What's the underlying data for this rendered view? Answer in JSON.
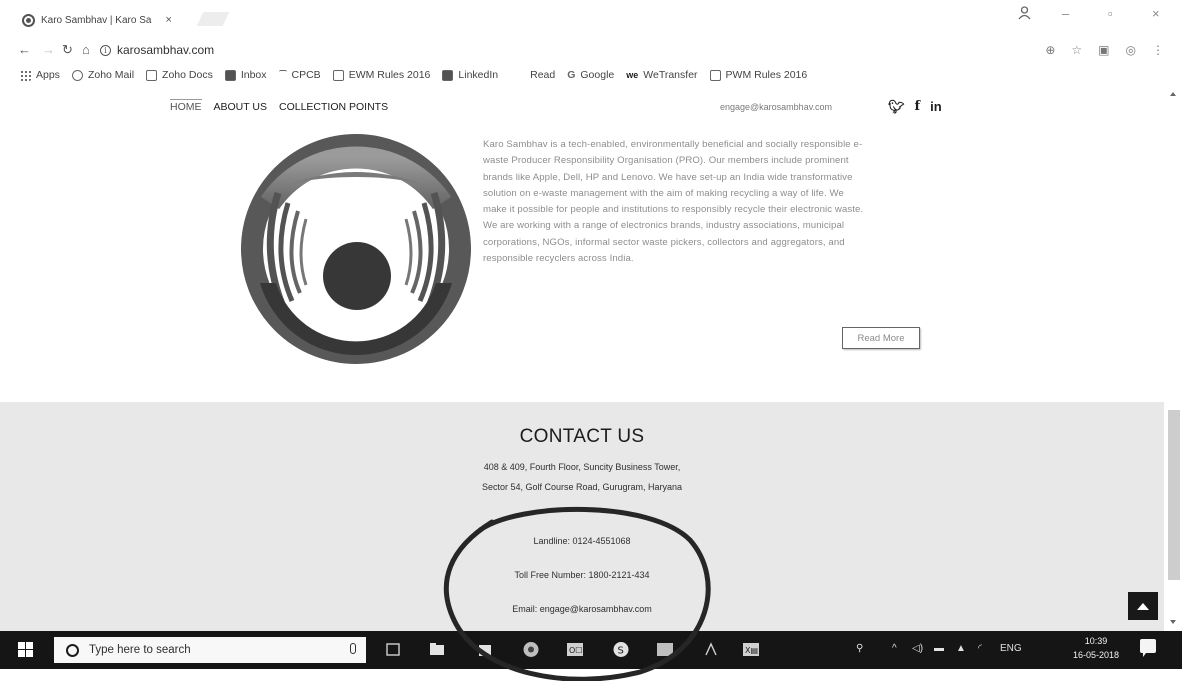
{
  "browser": {
    "tab_title": "Karo Sambhav | Karo Sa",
    "tab_close": "×",
    "url": "karosambhav.com",
    "bookmarks": [
      {
        "label": "Apps",
        "icon": "apps-grid-icon"
      },
      {
        "label": "Zoho Mail",
        "icon": "zoho-mail-icon"
      },
      {
        "label": "Zoho Docs",
        "icon": "zoho-docs-icon"
      },
      {
        "label": "Inbox",
        "icon": "inbox-icon"
      },
      {
        "label": "CPCB",
        "icon": "page-icon"
      },
      {
        "label": "EWM Rules 2016",
        "icon": "page-icon"
      },
      {
        "label": "LinkedIn",
        "icon": "linkedin-icon"
      },
      {
        "label": "Read",
        "icon": "read-icon"
      },
      {
        "label": "Google",
        "icon": "google-icon"
      },
      {
        "label": "WeTransfer",
        "icon": "wetransfer-icon"
      },
      {
        "label": "PWM Rules 2016",
        "icon": "page-icon"
      }
    ]
  },
  "site": {
    "nav": [
      "HOME",
      "ABOUT US",
      "COLLECTION POINTS"
    ],
    "email": "engage@karosambhav.com",
    "social": [
      "twitter-icon",
      "facebook-icon",
      "linkedin-icon"
    ],
    "about_lines": [
      "Karo Sambhav is a tech-enabled, environmentally beneficial and socially responsible e-",
      "waste Producer Responsibility Organisation (PRO). Our members include prominent",
      "brands like Apple, Dell, HP and Lenovo. We have set-up an India wide transformative",
      "solution on e-waste management with the aim of making recycling a way of life. We",
      "make it possible for people and institutions to responsibly recycle their electronic waste.",
      "We are working with a range of electronics brands, industry associations, municipal",
      "corporations, NGOs, informal sector waste pickers, collectors and aggregators, and",
      "responsible recyclers across India."
    ],
    "read_more": "Read More"
  },
  "contact": {
    "title": "CONTACT US",
    "address_1": "408 & 409, Fourth Floor, Suncity Business Tower,",
    "address_2": "Sector 54, Golf Course Road, Gurugram, Haryana",
    "landline": "Landline: 0124-4551068",
    "toll_free": "Toll Free Number: 1800-2121-434",
    "email": "Email: engage@karosambhav.com"
  },
  "taskbar": {
    "search_placeholder": "Type here to search",
    "language": "ENG",
    "time": "10:39",
    "date": "16-05-2018"
  },
  "colors": {
    "contact_bg": "#e3e3e3",
    "taskbar_bg": "#1a1a1a",
    "logo_dark": "#3a3a3a",
    "logo_grey": "#8a8a8a"
  }
}
